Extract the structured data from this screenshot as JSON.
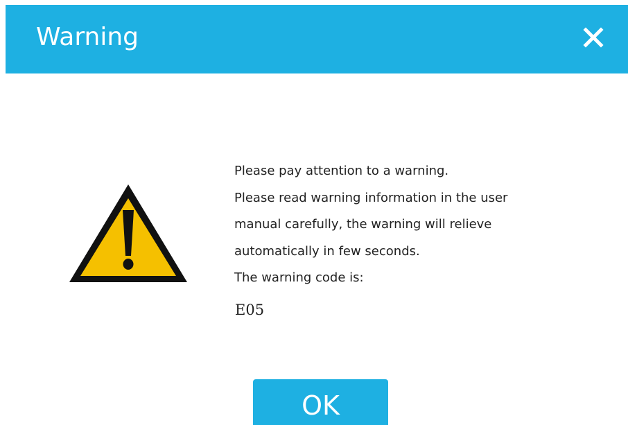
{
  "dialog": {
    "title": "Warning",
    "close_icon": "close-icon",
    "warning_icon": "warning-triangle-icon",
    "accent_color": "#1eb0e2",
    "icon_fill_color": "#f5c000",
    "message_lines": [
      "Please pay attention to a warning.",
      "Please read warning information in the user",
      "manual carefully, the warning will relieve",
      "automatically in few seconds.",
      "The warning code is:"
    ],
    "code": "E05",
    "ok_label": "OK"
  }
}
